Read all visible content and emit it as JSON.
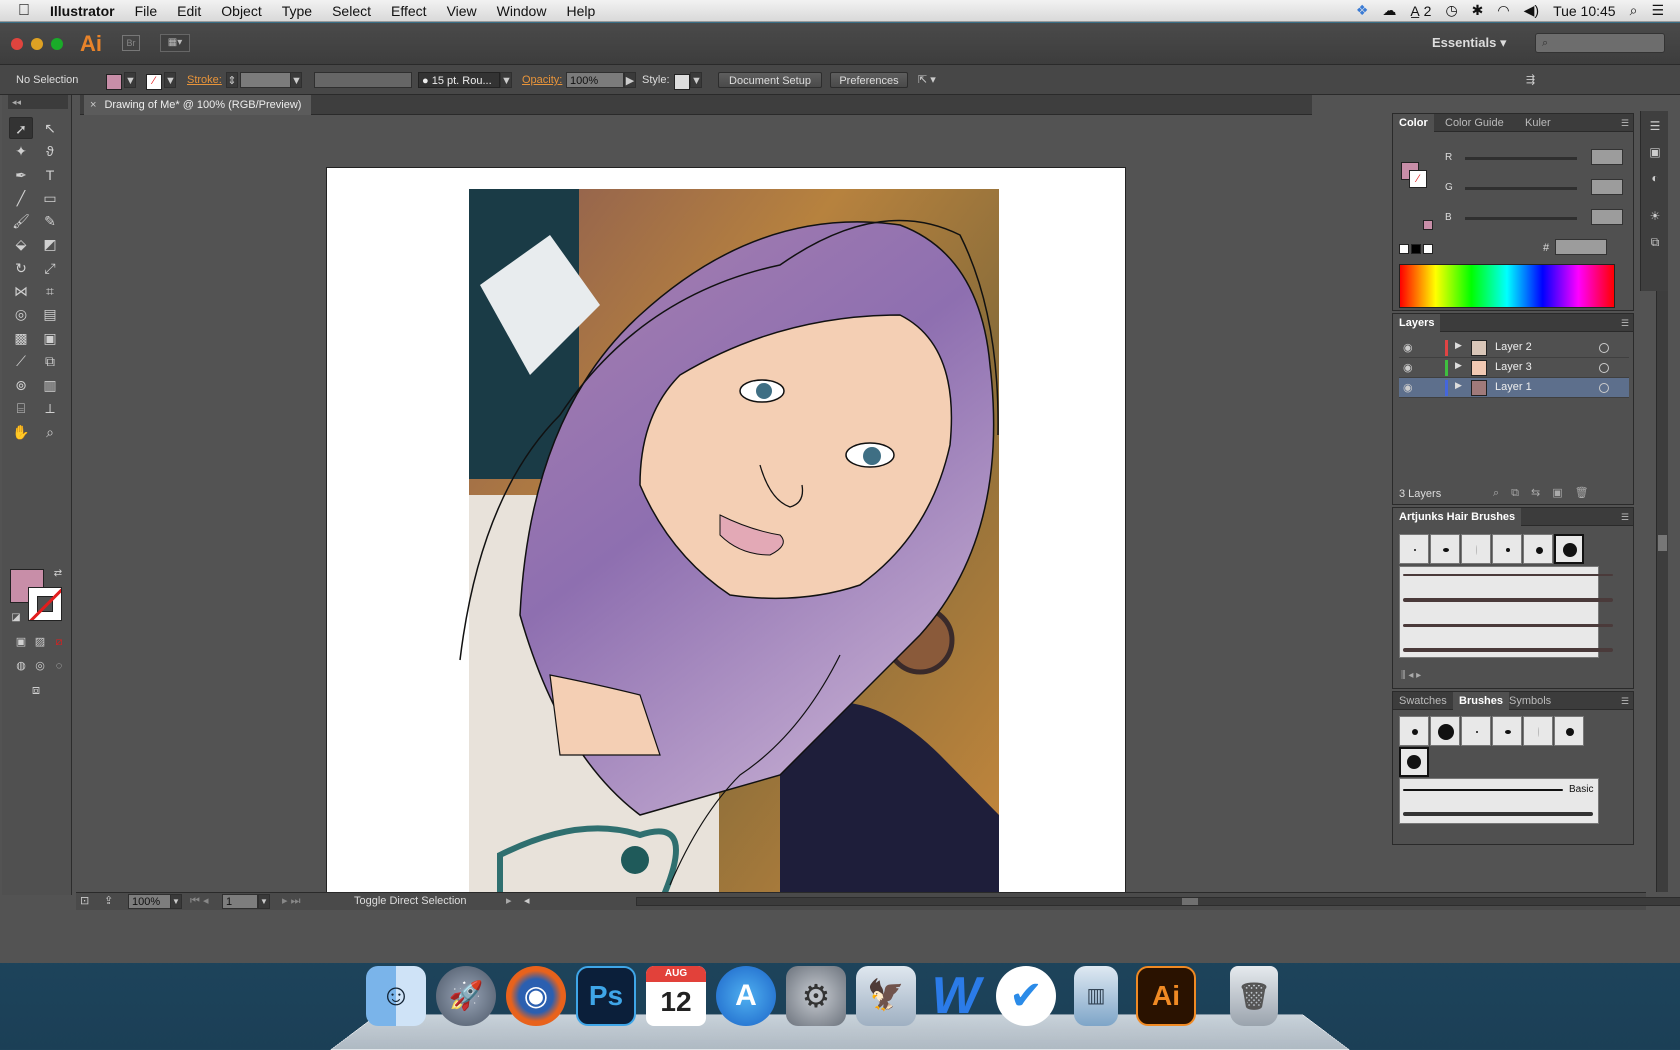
{
  "menubar": {
    "app_name": "Illustrator",
    "menus": [
      "File",
      "Edit",
      "Object",
      "Type",
      "Select",
      "Effect",
      "View",
      "Window",
      "Help"
    ],
    "status_items": {
      "ai_badge": "2",
      "clock": "Tue 10:45"
    }
  },
  "appbar": {
    "logo": "Ai",
    "bridge": "Br",
    "workspace": "Essentials"
  },
  "controlbar": {
    "selection": "No Selection",
    "stroke_label": "Stroke:",
    "brush_label": "15 pt. Rou...",
    "opacity_label": "Opacity:",
    "opacity_value": "100%",
    "style_label": "Style:",
    "document_setup": "Document Setup",
    "preferences": "Preferences"
  },
  "document": {
    "tab_title": "Drawing of Me* @ 100% (RGB/Preview)",
    "close": "×"
  },
  "statusbar": {
    "zoom": "100%",
    "artboard_num": "1",
    "status_text": "Toggle Direct Selection"
  },
  "color_panel": {
    "tabs": [
      "Color",
      "Color Guide",
      "Kuler"
    ],
    "channels": [
      "R",
      "G",
      "B"
    ],
    "hex_label": "#"
  },
  "layers_panel": {
    "title": "Layers",
    "layers": [
      {
        "name": "Layer 2",
        "color": "#e04444"
      },
      {
        "name": "Layer 3",
        "color": "#3fbf3f"
      },
      {
        "name": "Layer 1",
        "color": "#4466dd"
      }
    ],
    "count": "3 Layers"
  },
  "brushes_library": {
    "title": "Artjunks Hair Brushes"
  },
  "brushes_panel": {
    "tabs": [
      "Swatches",
      "Brushes",
      "Symbols"
    ],
    "basic_label": "Basic"
  },
  "dock": {
    "calendar_month": "AUG",
    "calendar_day": "12",
    "ps_label": "Ps",
    "ai_label": "Ai"
  },
  "colors": {
    "fill": "#c88ea8",
    "accent_orange": "#e8832a",
    "selected_layer": "#5d6f8c"
  }
}
